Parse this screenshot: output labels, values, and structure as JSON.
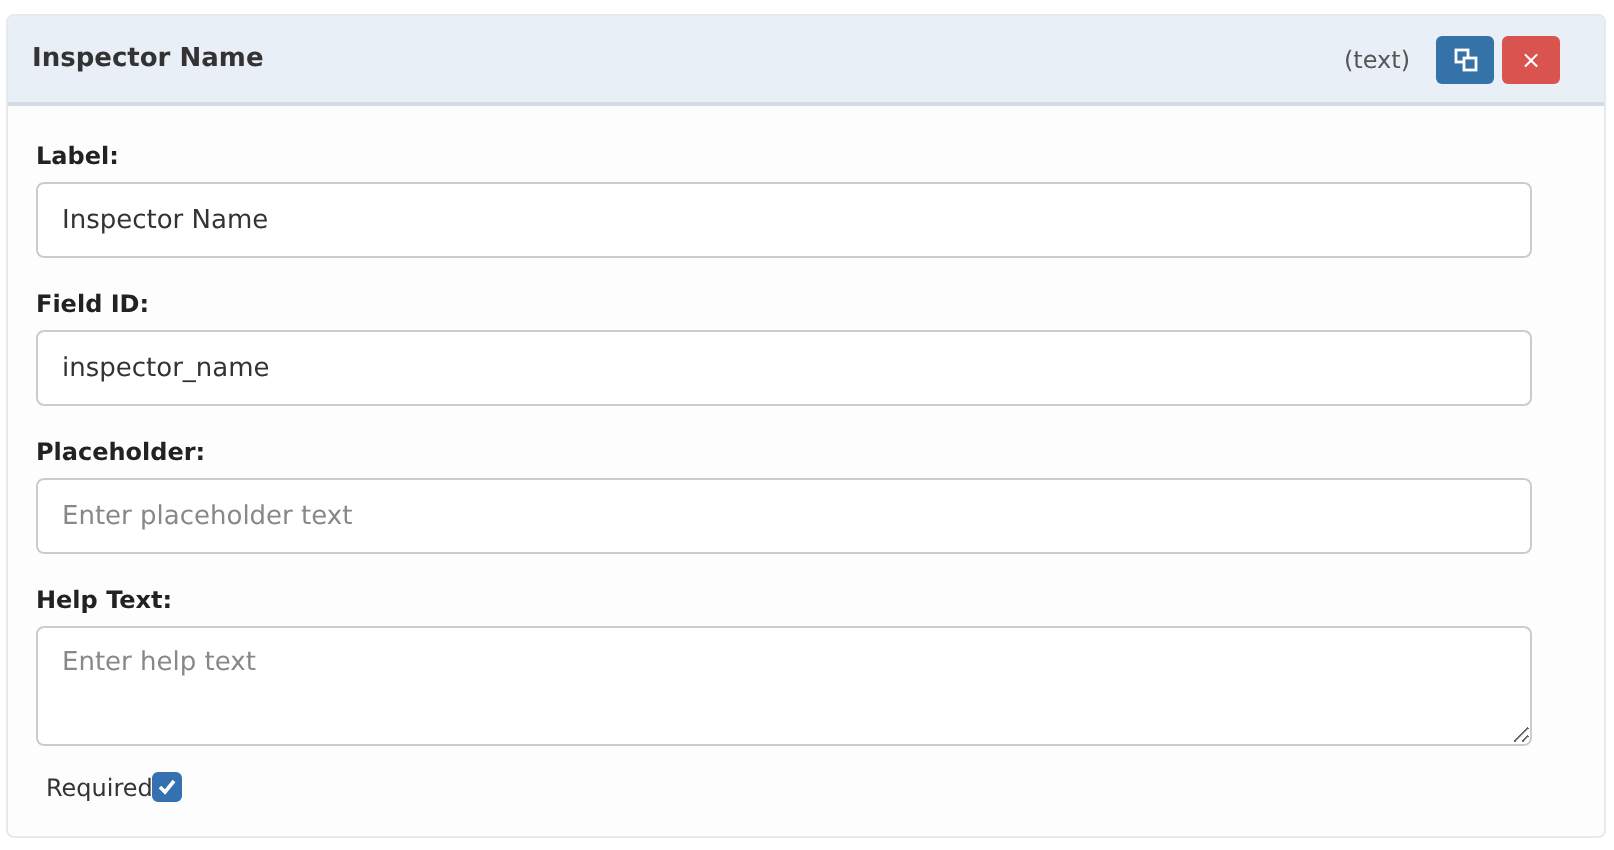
{
  "header": {
    "title": "Inspector Name",
    "type": "(text)",
    "close": "×"
  },
  "fields": [
    {
      "label": "Label:",
      "kind": "input",
      "value": "Inspector Name"
    },
    {
      "label": "Field ID:",
      "kind": "input",
      "value": "inspector_name"
    },
    {
      "label": "Placeholder:",
      "kind": "input",
      "placeholder": "Enter placeholder text"
    },
    {
      "label": "Help Text:",
      "kind": "textarea",
      "placeholder": "Enter help text"
    }
  ],
  "required": {
    "label": "Required",
    "checked": true
  }
}
